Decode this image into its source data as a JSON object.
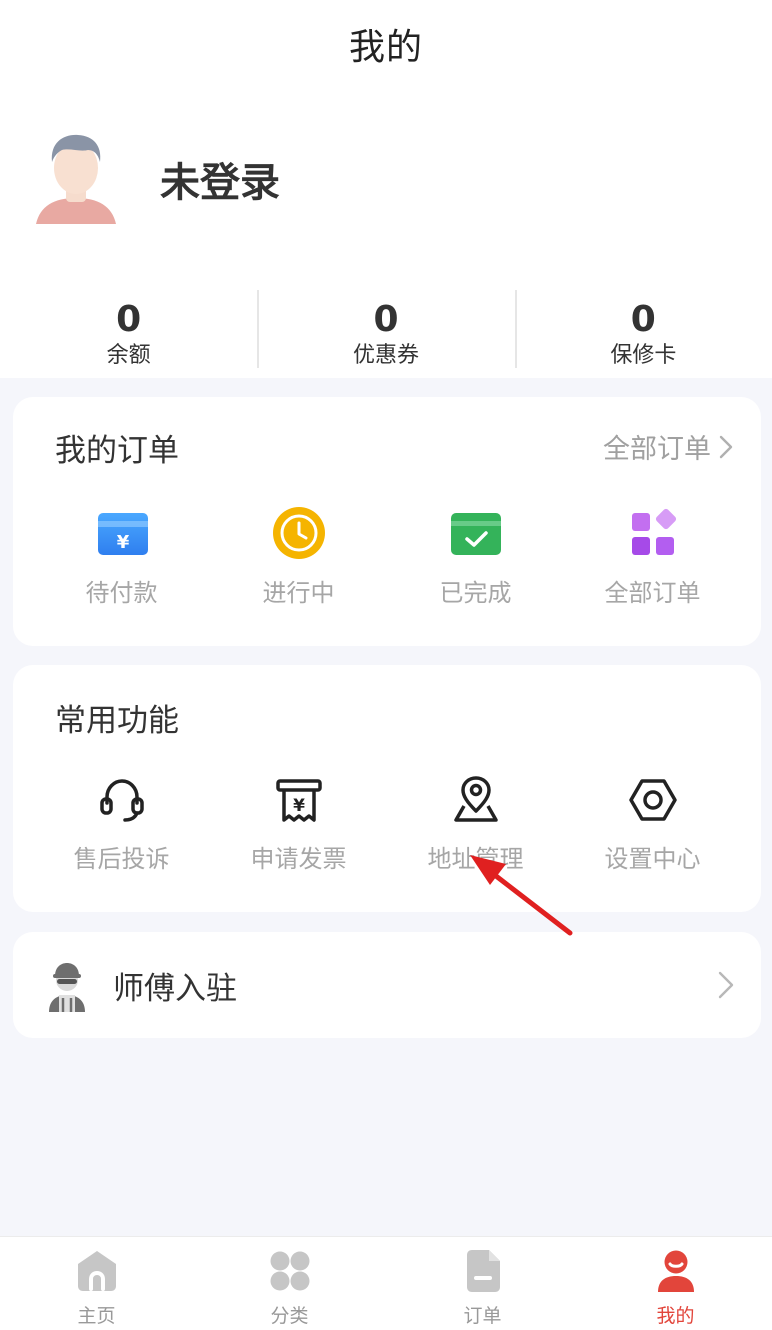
{
  "header": {
    "title": "我的"
  },
  "user": {
    "name": "未登录",
    "avatar_icon": "user-avatar-icon"
  },
  "stats": [
    {
      "value": "0",
      "label": "余额"
    },
    {
      "value": "0",
      "label": "优惠券"
    },
    {
      "value": "0",
      "label": "保修卡"
    }
  ],
  "orders": {
    "title": "我的订单",
    "all_link": "全部订单",
    "items": [
      {
        "label": "待付款",
        "icon": "yuan-card-icon"
      },
      {
        "label": "进行中",
        "icon": "clock-icon"
      },
      {
        "label": "已完成",
        "icon": "check-card-icon"
      },
      {
        "label": "全部订单",
        "icon": "grid-icon"
      }
    ]
  },
  "functions": {
    "title": "常用功能",
    "items": [
      {
        "label": "售后投诉",
        "icon": "headset-icon"
      },
      {
        "label": "申请发票",
        "icon": "invoice-icon"
      },
      {
        "label": "地址管理",
        "icon": "location-icon"
      },
      {
        "label": "设置中心",
        "icon": "settings-hexagon-icon"
      }
    ]
  },
  "master": {
    "label": "师傅入驻",
    "icon": "worker-icon"
  },
  "tabbar": {
    "items": [
      {
        "label": "主页",
        "icon": "home-icon",
        "active": false
      },
      {
        "label": "分类",
        "icon": "category-icon",
        "active": false
      },
      {
        "label": "订单",
        "icon": "order-icon",
        "active": false
      },
      {
        "label": "我的",
        "icon": "profile-icon",
        "active": true
      }
    ]
  },
  "colors": {
    "accent": "#e2453b",
    "arrow": "#e02020",
    "background": "#f5f6fb"
  }
}
